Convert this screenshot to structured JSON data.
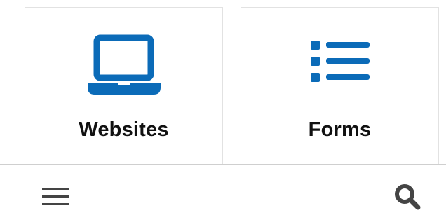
{
  "cards": [
    {
      "label": "Websites",
      "icon": "laptop-icon"
    },
    {
      "label": "Forms",
      "icon": "list-icon"
    }
  ],
  "bottom_bar": {
    "menu_icon": "hamburger-menu-icon",
    "search_icon": "search-icon"
  },
  "colors": {
    "icon_accent": "#0b6bb8",
    "label_text": "#111111",
    "divider": "#cfcfcf",
    "bar_icon": "#444444"
  }
}
